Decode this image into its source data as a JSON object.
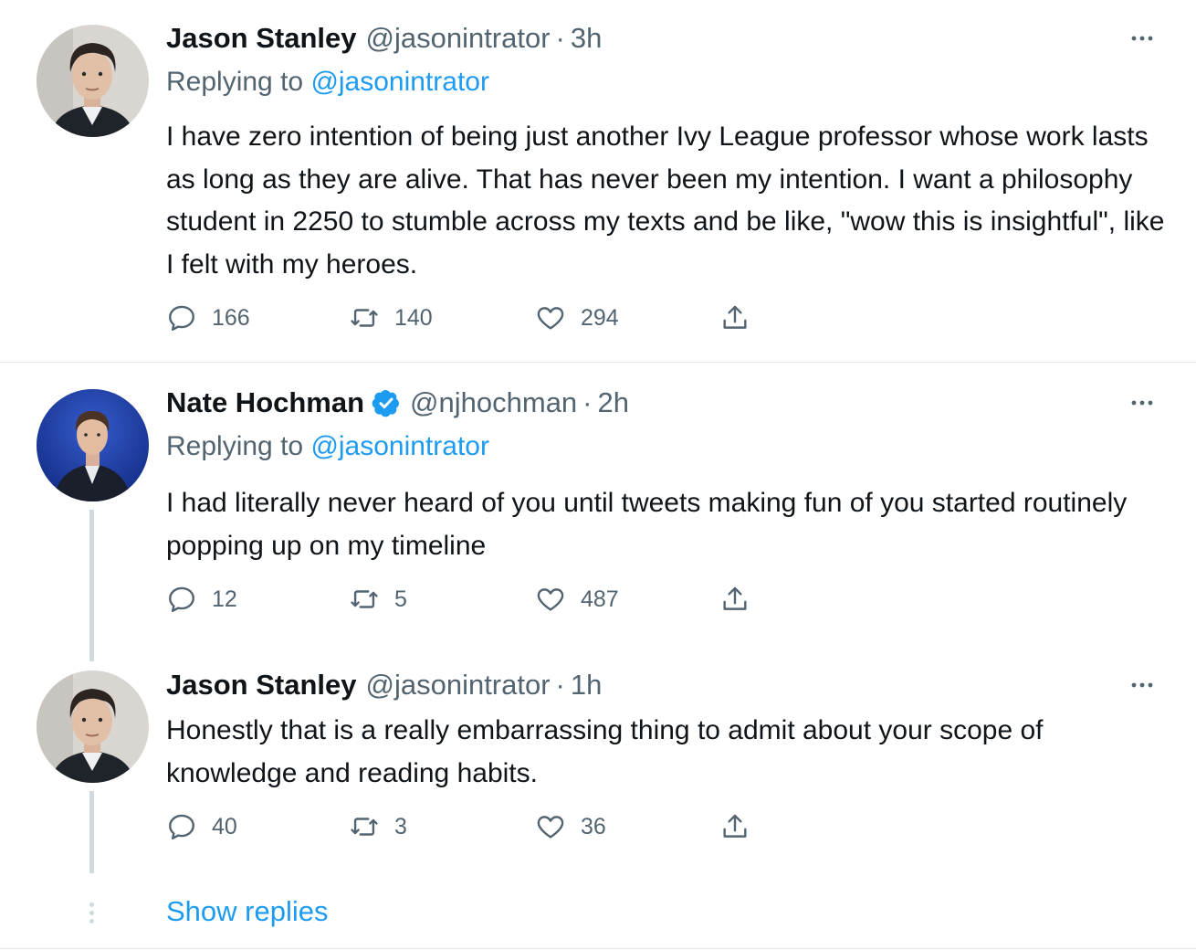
{
  "tweets": [
    {
      "author": "Jason Stanley",
      "handle": "@jasonintrator",
      "separator": "·",
      "time": "3h",
      "replying_prefix": "Replying to",
      "replying_to": "@jasonintrator",
      "text": "I have zero intention of being just another Ivy League professor whose work lasts as long as they are alive. That has never been my intention. I want a philosophy student in 2250 to stumble across my texts and be like, \"wow this is insightful\", like I felt with my heroes.",
      "replies": "166",
      "retweets": "140",
      "likes": "294"
    },
    {
      "author": "Nate Hochman",
      "verified": true,
      "handle": "@njhochman",
      "separator": "·",
      "time": "2h",
      "replying_prefix": "Replying to",
      "replying_to": "@jasonintrator",
      "text": "I had literally never heard of you until tweets making fun of you started routinely popping up on my timeline",
      "replies": "12",
      "retweets": "5",
      "likes": "487"
    },
    {
      "author": "Jason Stanley",
      "handle": "@jasonintrator",
      "separator": "·",
      "time": "1h",
      "text": "Honestly that is a really embarrassing thing to admit about your scope of knowledge and reading habits.",
      "replies": "40",
      "retweets": "3",
      "likes": "36"
    }
  ],
  "show_replies": "Show replies",
  "icons": {
    "reply": "reply-icon",
    "retweet": "retweet-icon",
    "like": "heart-icon",
    "share": "share-icon",
    "more": "more-icon",
    "verified": "verified-badge-icon"
  },
  "colors": {
    "link": "#1d9bf0",
    "secondary_text": "#536471",
    "primary_text": "#0f1419",
    "thread_line": "#cfd9de",
    "divider": "#e4e7e9"
  }
}
